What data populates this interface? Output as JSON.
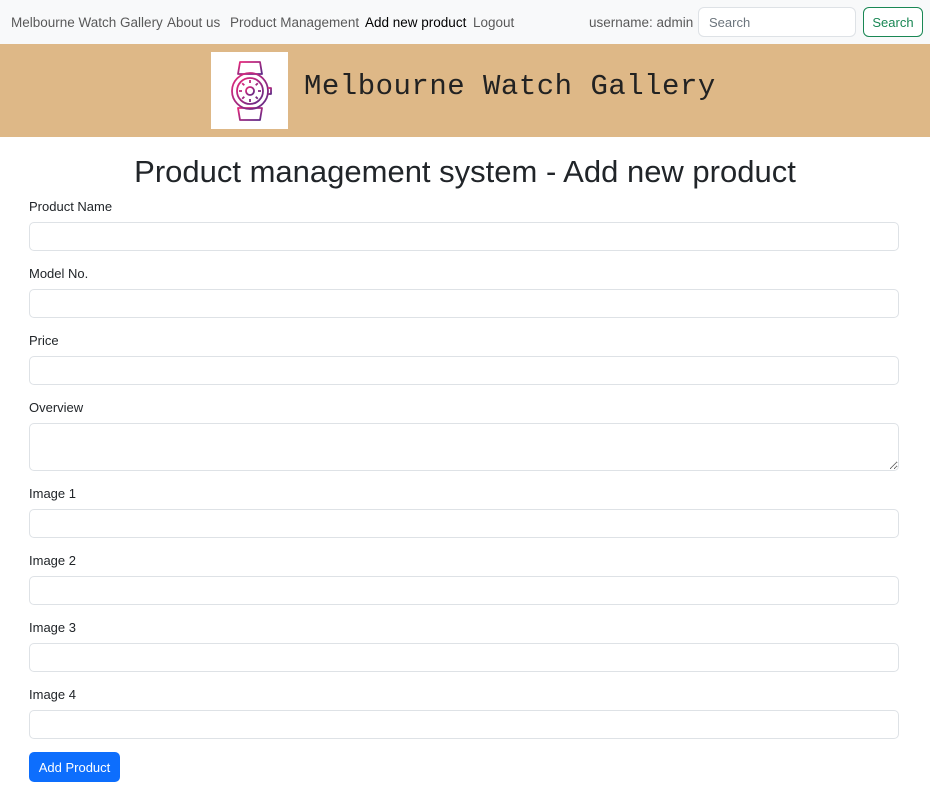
{
  "navbar": {
    "brand": "Melbourne Watch Gallery",
    "links": [
      {
        "label": "About us",
        "active": false
      },
      {
        "label": "Product Management",
        "active": false
      },
      {
        "label": "Add new product",
        "active": true
      },
      {
        "label": "Logout",
        "active": false
      }
    ],
    "user_text": "username: admin",
    "search_placeholder": "Search",
    "search_button": "Search"
  },
  "banner": {
    "logo_icon": "watch-icon",
    "title": "Melbourne Watch Gallery",
    "color": "#deb887"
  },
  "form": {
    "heading": "Product management system - Add new product",
    "fields": [
      {
        "label": "Product Name",
        "value": ""
      },
      {
        "label": "Model No.",
        "value": ""
      },
      {
        "label": "Price",
        "value": ""
      },
      {
        "label": "Overview",
        "value": ""
      },
      {
        "label": "Image 1",
        "value": ""
      },
      {
        "label": "Image 2",
        "value": ""
      },
      {
        "label": "Image 3",
        "value": ""
      },
      {
        "label": "Image 4",
        "value": ""
      }
    ],
    "submit_label": "Add Product"
  },
  "colors": {
    "primary": "#0d6efd",
    "success": "#198754",
    "banner": "#deb887"
  }
}
